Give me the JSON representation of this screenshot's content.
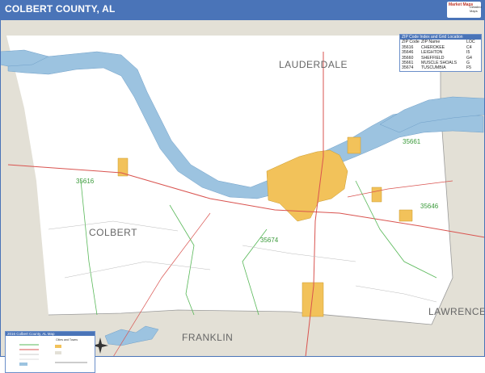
{
  "header": {
    "title": "COLBERT COUNTY, AL"
  },
  "logo": {
    "line1": "Market Maps",
    "line2": "Detailed Maps"
  },
  "zip_table": {
    "caption": "ZIP Code Index and Grid Location",
    "columns": [
      "ZIP Code",
      "ZIP Name",
      "LOC"
    ],
    "rows": [
      [
        "35616",
        "CHEROKEE",
        "C4"
      ],
      [
        "35646",
        "LEIGHTON",
        "I5"
      ],
      [
        "35660",
        "SHEFFIELD",
        "G4"
      ],
      [
        "35661",
        "MUSCLE SHOALS",
        "G"
      ],
      [
        "35674",
        "TUSCUMBIA",
        "F5"
      ]
    ]
  },
  "map": {
    "county_labels": [
      "LAUDERDALE",
      "COLBERT",
      "FRANKLIN",
      "LAWRENCE"
    ],
    "zip_labels": [
      "35616",
      "35661",
      "35646",
      "35674"
    ],
    "colors": {
      "outside": "#e3e0d6",
      "county": "#ffffff",
      "water": "#9cc3e0",
      "urban": "#f2c25a",
      "highway": "#d9534f",
      "zip_boundary": "#58b858"
    }
  },
  "legend": {
    "title": "2016 Colbert County, AL Map",
    "subtitle": "Cities and Towns"
  }
}
